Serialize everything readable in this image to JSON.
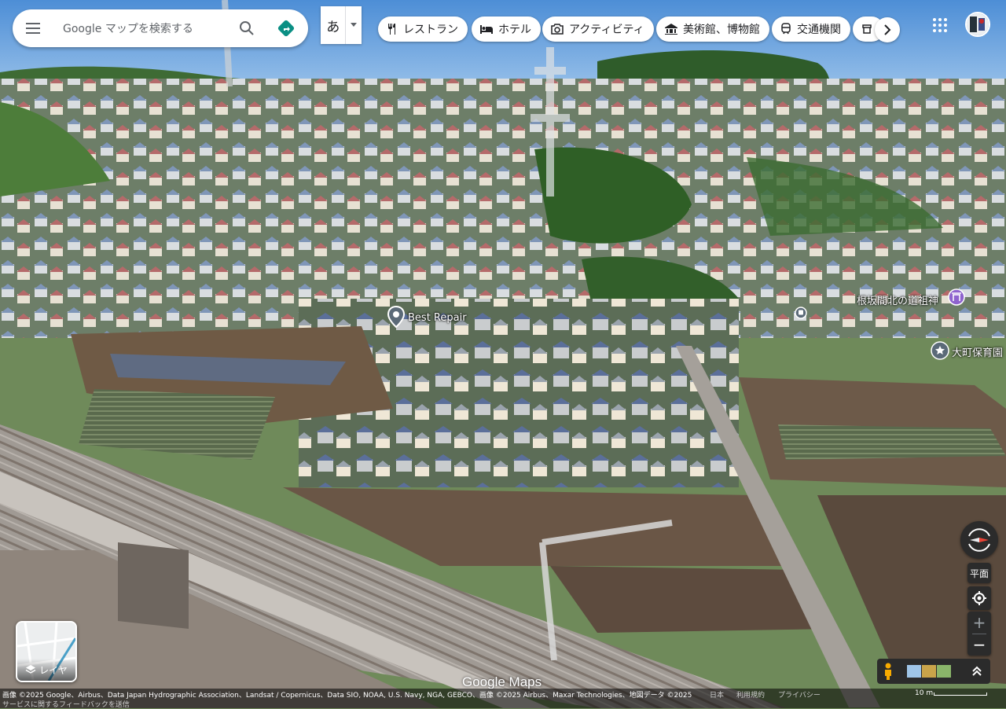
{
  "search": {
    "placeholder": "Google マップを検索する"
  },
  "ime": {
    "label": "あ"
  },
  "categories": [
    {
      "label": "レストラン",
      "icon": "fork-knife-icon"
    },
    {
      "label": "ホテル",
      "icon": "bed-icon"
    },
    {
      "label": "アクティビティ",
      "icon": "camera-icon"
    },
    {
      "label": "美術館、博物館",
      "icon": "museum-icon"
    },
    {
      "label": "交通機関",
      "icon": "train-icon"
    }
  ],
  "places": [
    {
      "name": "Best Repair",
      "icon": "map-pin-icon"
    },
    {
      "name": "根坂間北の道祖神",
      "icon": "shrine-icon"
    },
    {
      "name": "大町保育園",
      "icon": "school-icon"
    }
  ],
  "layers": {
    "label": "レイヤ"
  },
  "controls": {
    "flat_label": "平面",
    "zoom_in": "+",
    "zoom_out": "−"
  },
  "brand": {
    "watermark": "Google Maps"
  },
  "footer": {
    "attribution": "画像 ©2025 Google、Airbus、Data Japan Hydrographic Association、Landsat / Copernicus、Data SIO, NOAA, U.S. Navy, NGA, GEBCO、画像 ©2025 Airbus、Maxar Technologies、地図データ ©2025",
    "feedback": "サービスに関するフィードバックを送信",
    "japan": "日本",
    "terms": "利用規約",
    "privacy": "プライバシー",
    "scale": "10 m"
  },
  "colors": {
    "accent_directions": "#0a8f84",
    "compass_red": "#ea4335",
    "control_bg": "#2b2b2b"
  }
}
